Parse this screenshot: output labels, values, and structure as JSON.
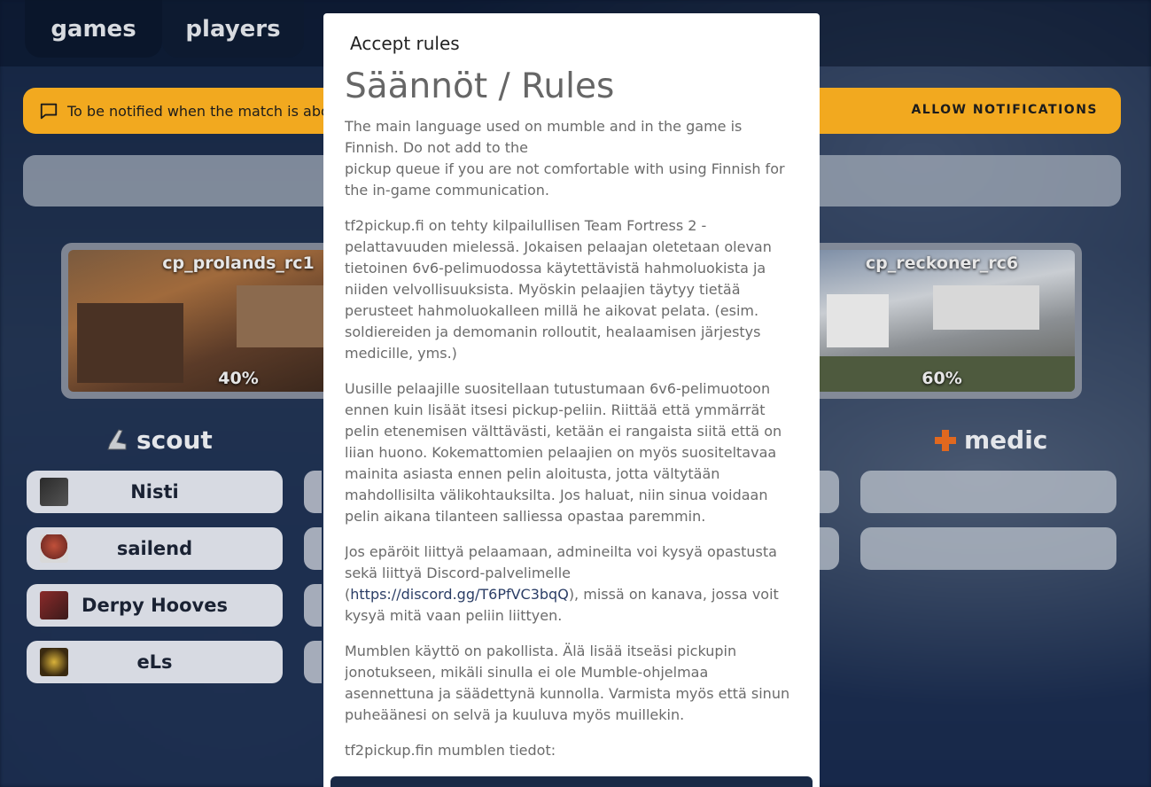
{
  "nav": {
    "games": "games",
    "players": "players"
  },
  "notification": {
    "text": "To be notified when the match is abo",
    "action": "ALLOW NOTIFICATIONS",
    "icon": "chat-bubble-icon"
  },
  "maps": [
    {
      "name": "cp_prolands_rc1",
      "percent": "40%"
    },
    {
      "name": "cp_reckoner_rc6",
      "percent": "60%"
    }
  ],
  "classes": {
    "scout": {
      "label": "scout",
      "icon": "boot-icon"
    },
    "medic": {
      "label": "medic",
      "icon": "medic-cross-icon"
    }
  },
  "scout_players": [
    {
      "name": "Nisti"
    },
    {
      "name": "sailend"
    },
    {
      "name": "Derpy Hooves"
    },
    {
      "name": "eLs"
    }
  ],
  "modal": {
    "title": "Accept rules",
    "heading": "Säännöt / Rules",
    "p1a": "The main language used on mumble and in the game is Finnish. Do not add to the",
    "p1b": "pickup queue if you are not comfortable with using Finnish for the in-game communication.",
    "p2": "tf2pickup.fi on tehty kilpailullisen Team Fortress 2 -pelattavuuden mielessä. Jokaisen pelaajan oletetaan olevan tietoinen 6v6-pelimuodossa käytettävistä hahmoluokista ja niiden velvollisuuksista. Myöskin pelaajien täytyy tietää perusteet hahmoluokalleen millä he aikovat pelata. (esim. soldiereiden ja demomanin rolloutit, healaamisen järjestys medicille, yms.)",
    "p3": "Uusille pelaajille suositellaan tutustumaan 6v6-pelimuotoon ennen kuin lisäät itsesi pickup-peliin. Riittää että ymmärrät pelin etenemisen välttävästi, ketään ei rangaista siitä että on liian huono. Kokemattomien pelaajien on myös suositeltavaa mainita asiasta ennen pelin aloitusta, jotta vältytään mahdollisilta välikohtauksilta. Jos haluat, niin sinua voidaan pelin aikana tilanteen salliessa opastaa paremmin.",
    "p4a": "Jos epäröit liittyä pelaamaan, admineilta voi kysyä opastusta sekä liittyä Discord-palvelimelle (",
    "p4link": "https://discord.gg/T6PfVC3bqQ",
    "p4b": "), missä on kanava, jossa voit kysyä mitä vaan peliin liittyen.",
    "p5": "Mumblen käyttö on pakollista. Älä lisää itseäsi pickupin jonotukseen, mikäli sinulla ei ole Mumble-ohjelmaa asennettuna ja säädettynä kunnolla. Varmista myös että sinun puheäänesi on selvä ja kuuluva myös muillekin.",
    "p6": "tf2pickup.fin mumblen tiedot:"
  }
}
